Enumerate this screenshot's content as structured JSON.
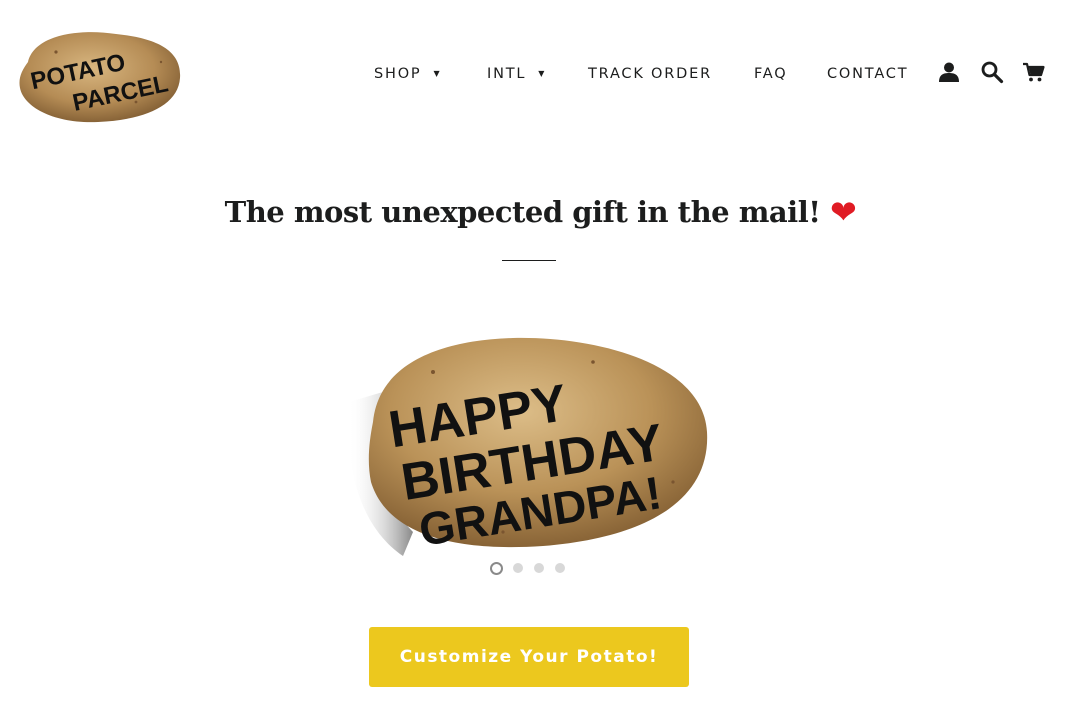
{
  "brand": {
    "logo_line1": "POTATO",
    "logo_line2": "PARCEL"
  },
  "nav": {
    "items": [
      {
        "label": "SHOP",
        "has_dropdown": true
      },
      {
        "label": "INTL",
        "has_dropdown": true
      },
      {
        "label": "TRACK ORDER",
        "has_dropdown": false
      },
      {
        "label": "FAQ",
        "has_dropdown": false
      },
      {
        "label": "CONTACT",
        "has_dropdown": false
      }
    ],
    "caret": "▼",
    "icons": [
      "account-icon",
      "search-icon",
      "cart-icon"
    ]
  },
  "hero": {
    "headline": "The most unexpected gift in the mail!",
    "heart": "❤",
    "slide_text_line1": "HAPPY",
    "slide_text_line2": "BIRTHDAY",
    "slide_text_line3": "GRANDPA!",
    "slide_count": 4,
    "active_slide": 1,
    "cta_label": "Customize Your Potato!"
  },
  "colors": {
    "accent": "#ecc81e",
    "heart": "#e01b24",
    "text": "#1c1d1d",
    "potato": "#b8915a"
  }
}
